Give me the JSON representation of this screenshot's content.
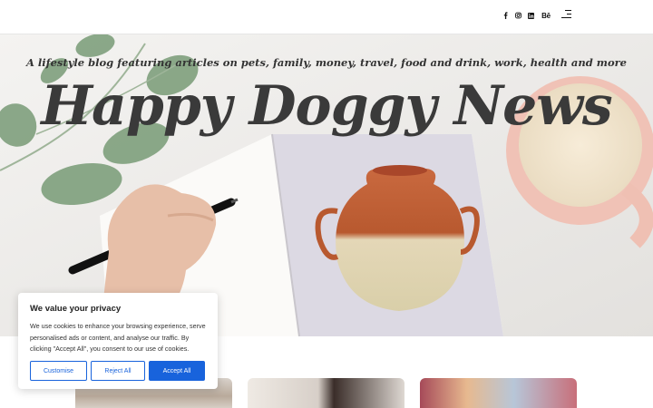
{
  "header": {
    "social": [
      {
        "icon": "facebook-icon",
        "label": "f"
      },
      {
        "icon": "instagram-icon",
        "label": ""
      },
      {
        "icon": "linkedin-icon",
        "label": ""
      },
      {
        "icon": "behance-icon",
        "label": "Bē"
      }
    ],
    "menu_icon": "hamburger-menu-icon"
  },
  "hero": {
    "tagline": "A lifestyle blog featuring articles on pets, family, money, travel, food and drink, work, health and more",
    "title": "Happy Doggy News"
  },
  "cookie": {
    "title": "We value your privacy",
    "text": "We use cookies to enhance your browsing experience, serve personalised ads or content, and analyse our traffic. By clicking \"Accept All\", you consent to our use of cookies.",
    "customise_label": "Customise",
    "reject_label": "Reject All",
    "accept_label": "Accept All",
    "accent_color": "#1863dc"
  }
}
